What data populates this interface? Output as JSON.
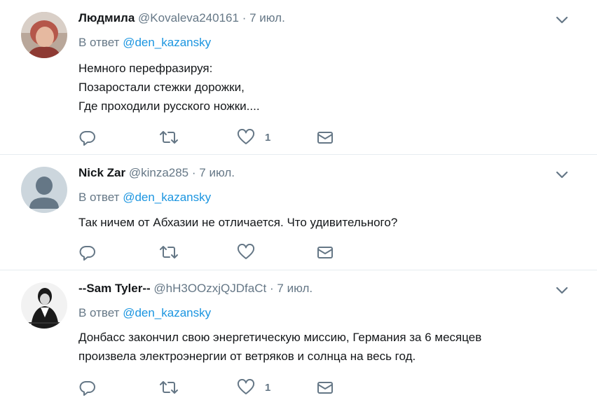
{
  "tweets": [
    {
      "name": "Людмила",
      "handle": "@Kovaleva240161",
      "dot": "·",
      "time": "7 июл.",
      "reply_prefix": "В ответ",
      "reply_mention": "@den_kazansky",
      "lines": [
        "Немного перефразируя:",
        "Позаростали стежки дорожки,",
        "Где проходили русского ножки...."
      ],
      "like_count": "1",
      "icons": [
        "reply-icon",
        "retweet-icon",
        "like-icon",
        "message-icon",
        "chevron-down-icon"
      ]
    },
    {
      "name": "Nick Zar",
      "handle": "@kinza285",
      "dot": "·",
      "time": "7 июл.",
      "reply_prefix": "В ответ",
      "reply_mention": "@den_kazansky",
      "lines": [
        "Так ничем от Абхазии не отличается. Что удивительного?"
      ],
      "like_count": "",
      "icons": [
        "reply-icon",
        "retweet-icon",
        "like-icon",
        "message-icon",
        "chevron-down-icon"
      ]
    },
    {
      "name": "--Sam Tyler--",
      "handle": "@hH3OOzxjQJDfaCt",
      "dot": "·",
      "time": "7 июл.",
      "reply_prefix": "В ответ",
      "reply_mention": "@den_kazansky",
      "lines": [
        "Донбасс закончил свою энергетическую миссию, Германия за 6 месяцев",
        "произвела электроэнергии от ветряков и солнца на весь год."
      ],
      "like_count": "1",
      "icons": [
        "reply-icon",
        "retweet-icon",
        "like-icon",
        "message-icon",
        "chevron-down-icon"
      ]
    }
  ],
  "colors": {
    "text": "#14171a",
    "secondary": "#657786",
    "link": "#1b95e0",
    "divider": "#e6ecf0"
  }
}
